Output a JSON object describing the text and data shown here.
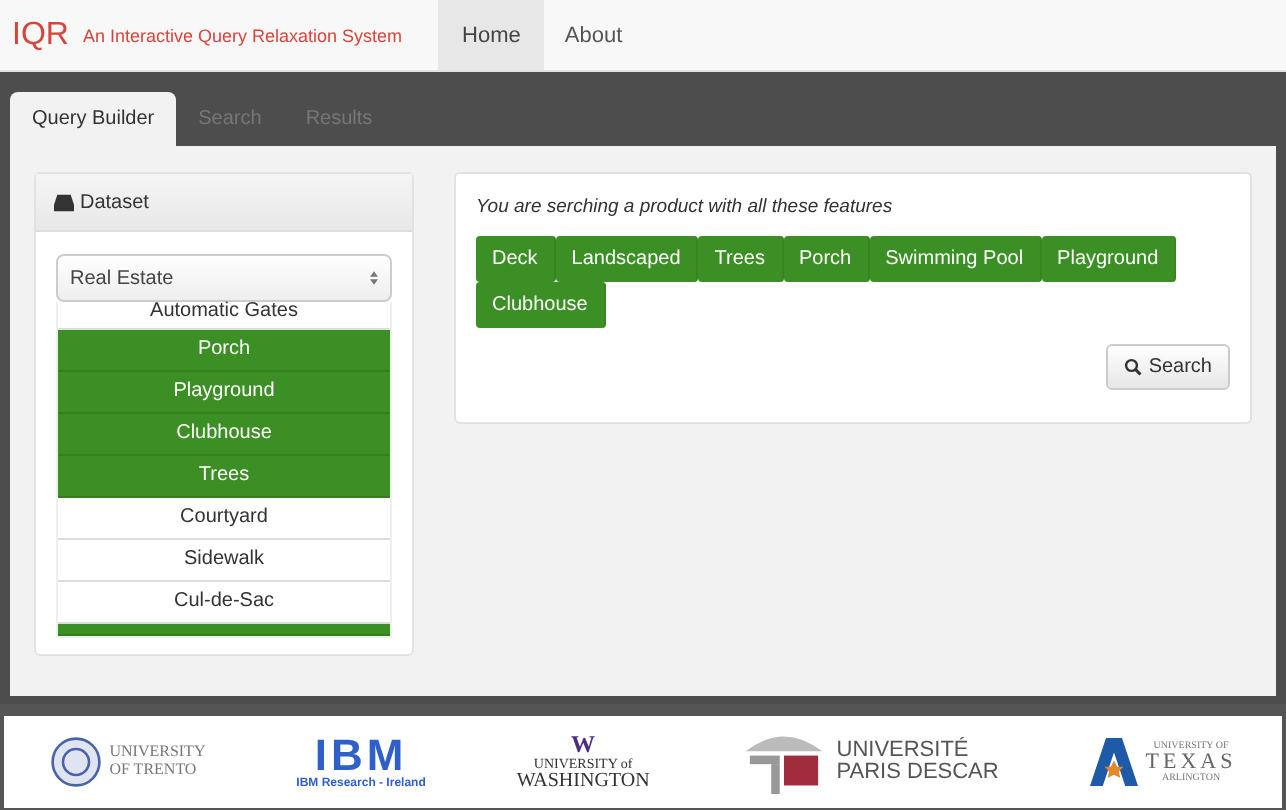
{
  "navbar": {
    "brand": "IQR",
    "tagline": "An Interactive Query Relaxation System",
    "links": [
      {
        "label": "Home",
        "selected": true
      },
      {
        "label": "About",
        "selected": false
      }
    ]
  },
  "tabs": [
    {
      "label": "Query Builder",
      "selected": true
    },
    {
      "label": "Search",
      "selected": false
    },
    {
      "label": "Results",
      "selected": false
    }
  ],
  "dataset_panel": {
    "title": "Dataset",
    "select_value": "Real Estate",
    "features": [
      {
        "label": "Automatic Gates",
        "selected": false
      },
      {
        "label": "Porch",
        "selected": true
      },
      {
        "label": "Playground",
        "selected": true
      },
      {
        "label": "Clubhouse",
        "selected": true
      },
      {
        "label": "Trees",
        "selected": true
      },
      {
        "label": "Courtyard",
        "selected": false
      },
      {
        "label": "Sidewalk",
        "selected": false
      },
      {
        "label": "Cul-de-Sac",
        "selected": false
      },
      {
        "selected": true
      }
    ]
  },
  "query_panel": {
    "intro": "You are serching a product with all these features",
    "chips": [
      "Deck",
      "Landscaped",
      "Trees",
      "Porch",
      "Swimming Pool",
      "Playground",
      "Clubhouse"
    ],
    "button": "Search"
  },
  "footer": {
    "logos": [
      {
        "kind": "trento",
        "lines": [
          "UNIVERSITY",
          "OF TRENTO"
        ]
      },
      {
        "kind": "ibm",
        "lines": [
          "IBM",
          "IBM Research - Ireland"
        ]
      },
      {
        "kind": "washington",
        "lines": [
          "W",
          "UNIVERSITY of",
          "WASHINGTON"
        ]
      },
      {
        "kind": "paris",
        "lines": [
          "UNIVERSITÉ",
          "PARIS DESCAR"
        ]
      },
      {
        "kind": "texas",
        "lines": [
          "UNIVERSITY OF",
          "TEXAS",
          "ARLINGTON"
        ]
      }
    ]
  }
}
